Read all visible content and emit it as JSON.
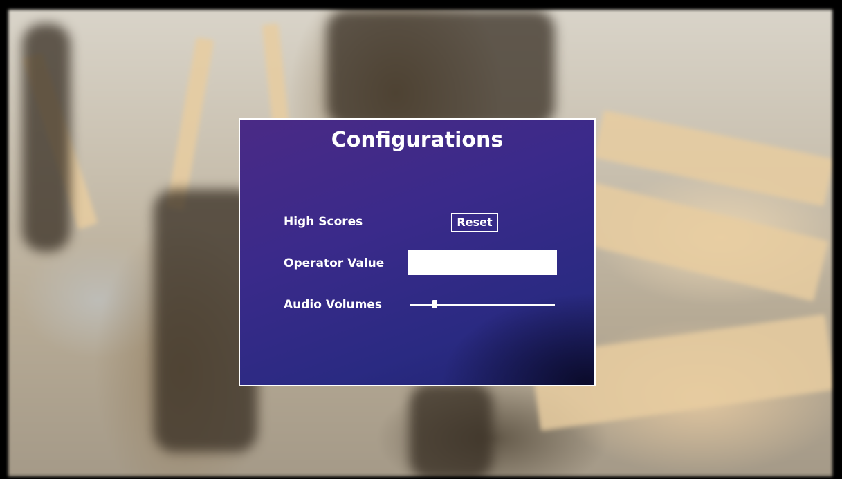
{
  "window": {
    "title": "Configurations"
  },
  "settings": {
    "high_scores": {
      "label": "High Scores",
      "button_label": "Reset"
    },
    "operator_value": {
      "label": "Operator Value",
      "value": "",
      "placeholder": ""
    },
    "audio_volumes": {
      "label": "Audio Volumes",
      "level": 0.17
    }
  },
  "colors": {
    "panel_gradient_start": "#4a2a86",
    "panel_gradient_end": "#1f2470",
    "border": "#ffffff",
    "text": "#ffffff"
  }
}
